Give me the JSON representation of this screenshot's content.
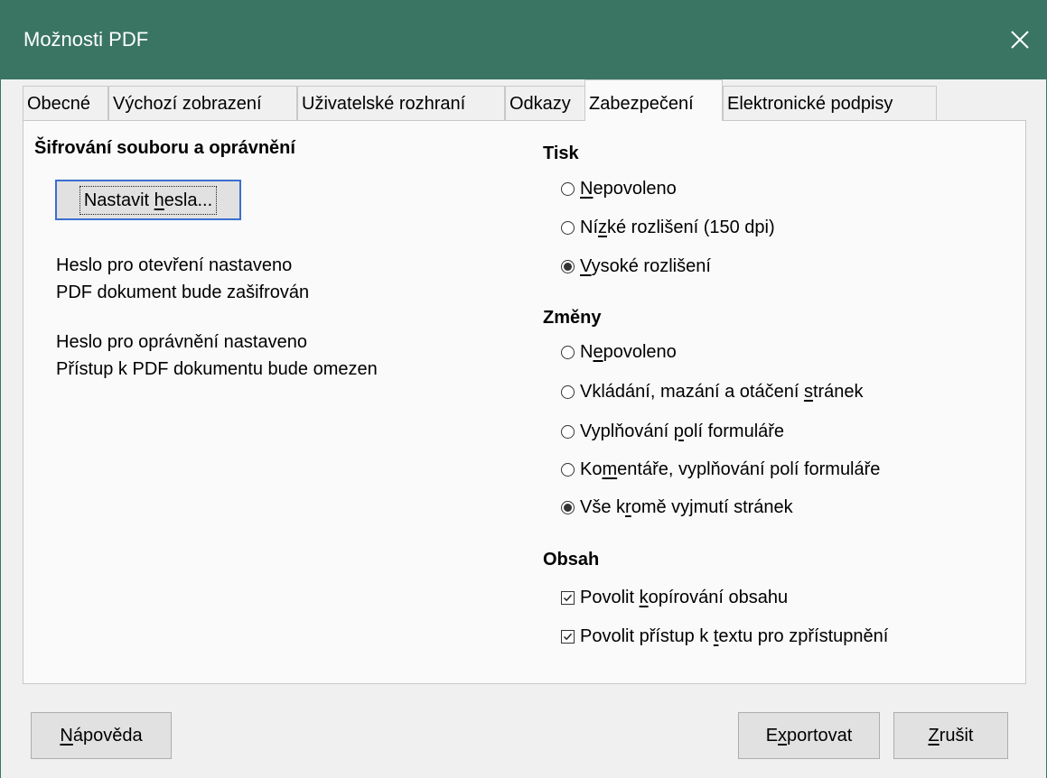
{
  "window": {
    "title": "Možnosti PDF"
  },
  "tabs": [
    {
      "label": "Obecné"
    },
    {
      "label": "Výchozí zobrazení"
    },
    {
      "label": "Uživatelské rozhraní"
    },
    {
      "label": "Odkazy"
    },
    {
      "label": "Zabezpečení",
      "active": true
    },
    {
      "label": "Elektronické podpisy"
    }
  ],
  "left": {
    "heading": "Šifrování souboru a oprávnění",
    "set_password_button": {
      "pre": "Nastavit ",
      "u": "h",
      "post": "esla..."
    },
    "status": [
      "Heslo pro otevření nastaveno",
      "PDF dokument bude zašifrován",
      "Heslo pro oprávnění nastaveno",
      "Přístup k PDF dokumentu bude omezen"
    ]
  },
  "print": {
    "heading": "Tisk",
    "options": [
      {
        "pre": "",
        "u": "N",
        "post": "epovoleno",
        "selected": false
      },
      {
        "pre": "Ní",
        "u": "z",
        "post": "ké rozlišení (150 dpi)",
        "selected": false
      },
      {
        "pre": "",
        "u": "V",
        "post": "ysoké rozlišení",
        "selected": true
      }
    ]
  },
  "changes": {
    "heading": "Změny",
    "options": [
      {
        "pre": "N",
        "u": "e",
        "post": "povoleno",
        "selected": false
      },
      {
        "pre": "Vkládání, mazání a otáčení ",
        "u": "s",
        "post": "tránek",
        "selected": false
      },
      {
        "pre": "Vyplňování ",
        "u": "p",
        "post": "olí formuláře",
        "selected": false
      },
      {
        "pre": "Ko",
        "u": "m",
        "post": "entáře, vyplňování polí formuláře",
        "selected": false
      },
      {
        "pre": "Vše k",
        "u": "r",
        "post": "omě vyjmutí stránek",
        "selected": true
      }
    ]
  },
  "content": {
    "heading": "Obsah",
    "options": [
      {
        "pre": "Povolit ",
        "u": "k",
        "post": "opírování obsahu",
        "checked": true
      },
      {
        "pre": "Povolit přístup k ",
        "u": "t",
        "post": "extu pro zpřístupnění",
        "checked": true
      }
    ]
  },
  "buttons": {
    "help": {
      "pre": "",
      "u": "N",
      "post": "ápověda"
    },
    "export": {
      "pre": "E",
      "u": "x",
      "post": "portovat"
    },
    "cancel": {
      "pre": "",
      "u": "Z",
      "post": "rušit"
    }
  },
  "colors": {
    "titlebar": "#3a7563",
    "focus_border": "#3c6fcf"
  }
}
